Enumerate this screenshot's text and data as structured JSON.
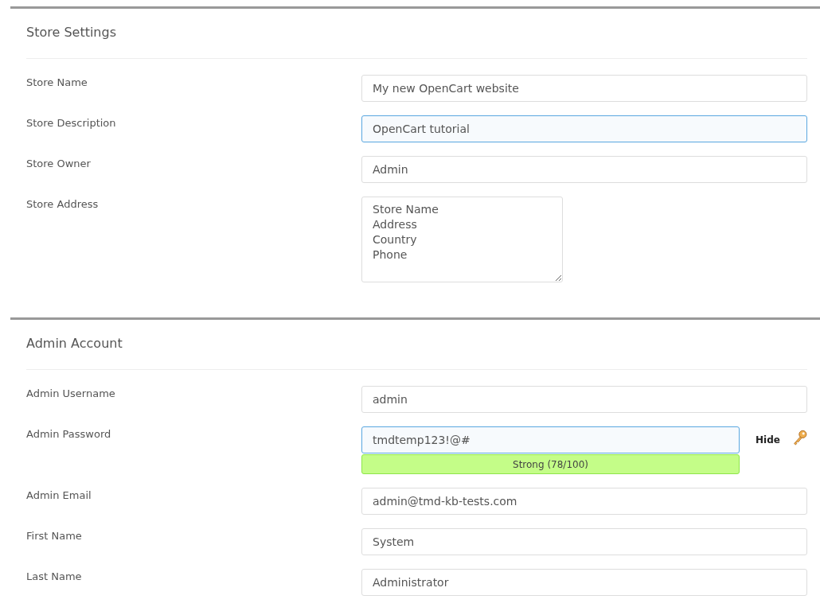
{
  "sections": [
    {
      "title": "Store Settings",
      "fields": [
        {
          "kind": "text",
          "label": "Store Name",
          "value": "My new OpenCart website",
          "focused": false
        },
        {
          "kind": "text",
          "label": "Store Description",
          "value": "OpenCart tutorial",
          "focused": true
        },
        {
          "kind": "text",
          "label": "Store Owner",
          "value": "Admin",
          "focused": false
        },
        {
          "kind": "textarea",
          "label": "Store Address",
          "value": "Store Name\nAddress\nCountry\nPhone",
          "focused": false
        }
      ]
    },
    {
      "title": "Admin Account",
      "fields": [
        {
          "kind": "text",
          "label": "Admin Username",
          "value": "admin",
          "focused": false
        },
        {
          "kind": "password",
          "label": "Admin Password",
          "value": "tmdtemp123!@#",
          "focused": true,
          "toggle": "Hide",
          "strength": "Strong (78/100)"
        },
        {
          "kind": "text",
          "label": "Admin Email",
          "value": "admin@tmd-kb-tests.com",
          "focused": false
        },
        {
          "kind": "text",
          "label": "First Name",
          "value": "System",
          "focused": false
        },
        {
          "kind": "text",
          "label": "Last Name",
          "value": "Administrator",
          "focused": false
        }
      ]
    }
  ]
}
